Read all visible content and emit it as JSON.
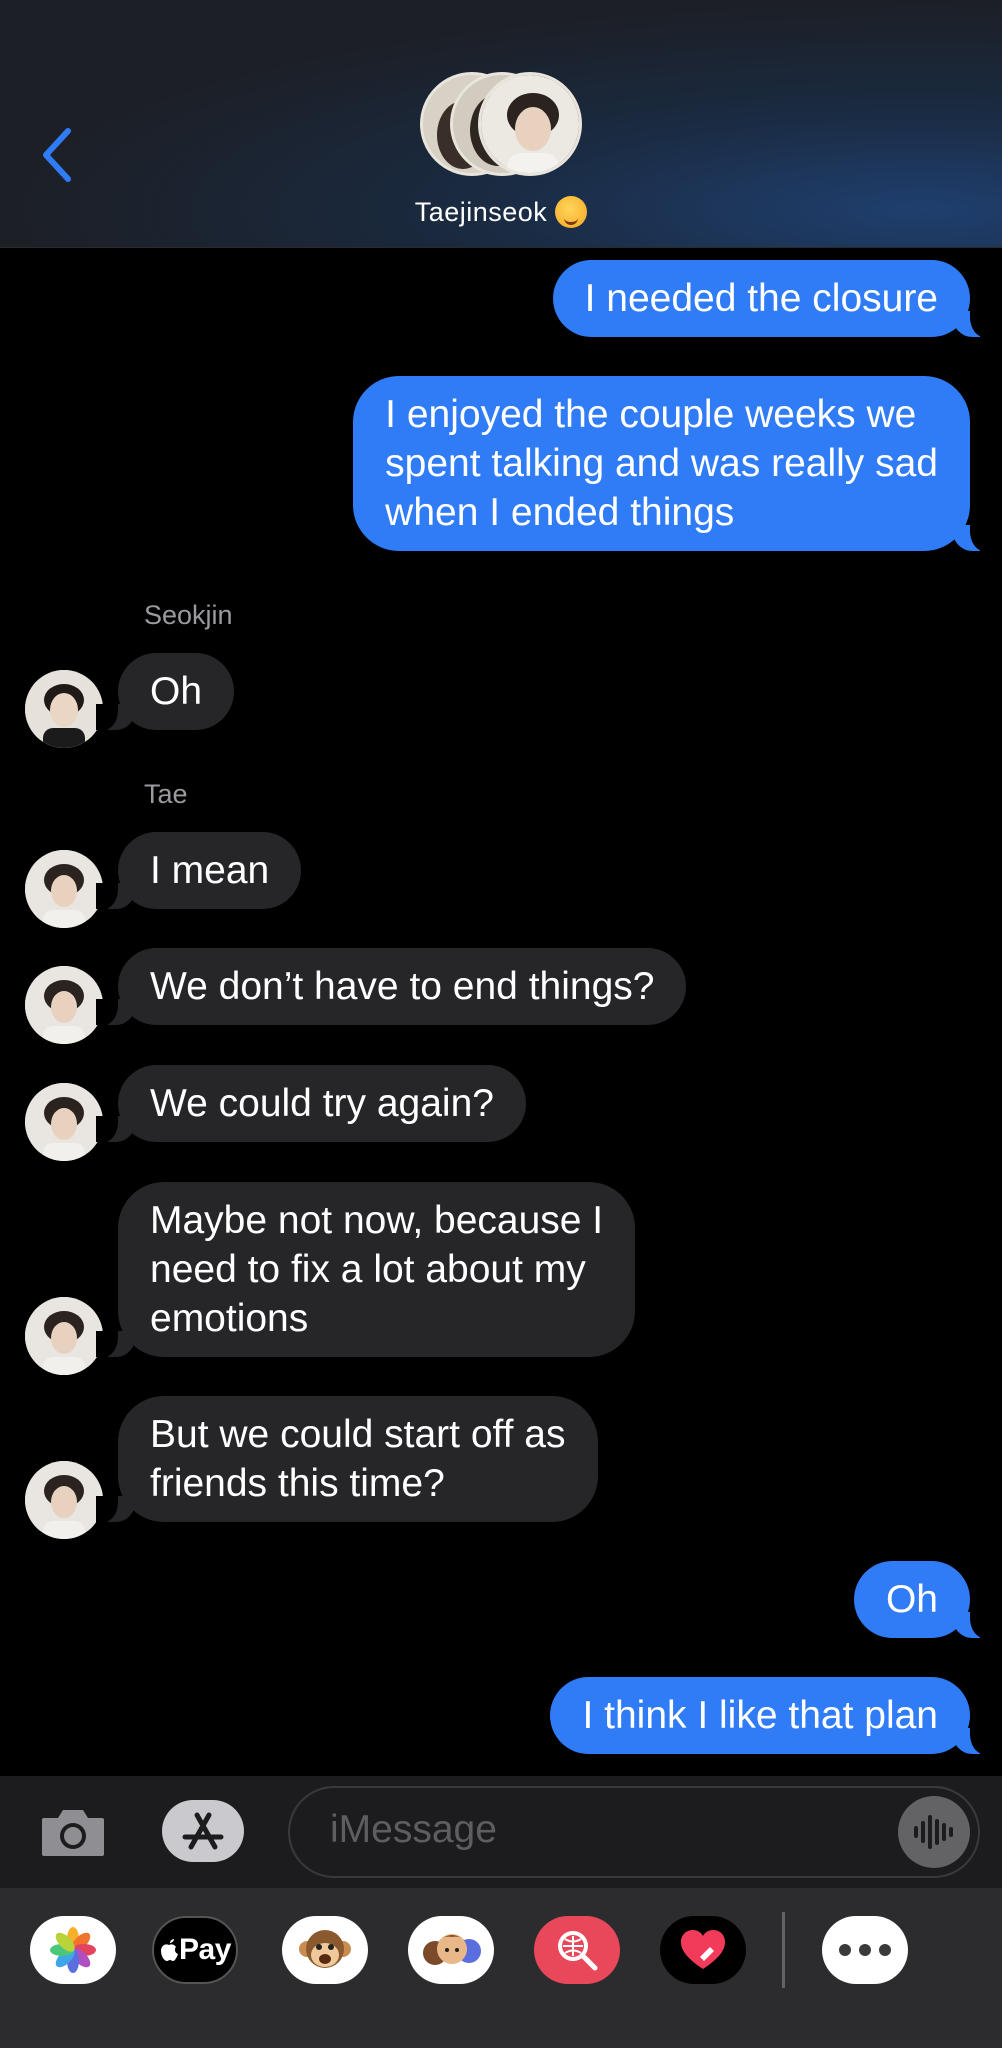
{
  "header": {
    "group_name": "Taejinseok",
    "emoji": "smiling-face-with-hearts-emoji"
  },
  "messages": [
    {
      "type": "outgoing",
      "text": "I needed the closure"
    },
    {
      "type": "outgoing",
      "lines": [
        "I enjoyed the couple weeks we",
        "spent talking and was really sad",
        "when I ended things"
      ]
    },
    {
      "type": "sender",
      "text": "Seokjin"
    },
    {
      "type": "incoming",
      "text": "Oh"
    },
    {
      "type": "sender",
      "text": "Tae"
    },
    {
      "type": "incoming",
      "text": "I mean"
    },
    {
      "type": "incoming",
      "text": "We don’t have to end things?"
    },
    {
      "type": "incoming",
      "text": "We could try again?"
    },
    {
      "type": "incoming",
      "lines": [
        "Maybe not now, because I",
        "need to fix a lot about my",
        "emotions"
      ]
    },
    {
      "type": "incoming",
      "lines": [
        "But we could start off as",
        "friends this time?"
      ]
    },
    {
      "type": "outgoing",
      "text": "Oh"
    },
    {
      "type": "outgoing",
      "text": "I think I like that plan"
    }
  ],
  "input": {
    "placeholder": "iMessage"
  },
  "apps": {
    "pay_label": "Pay",
    "items": [
      "photos-icon",
      "apple-pay-icon",
      "animoji-icon",
      "memoji-icon",
      "image-search-icon",
      "digital-touch-icon",
      "more-icon"
    ]
  },
  "colors": {
    "outgoing_bubble": "#2f7cf6",
    "incoming_bubble": "#262629",
    "accent": "#2f7cf6"
  }
}
